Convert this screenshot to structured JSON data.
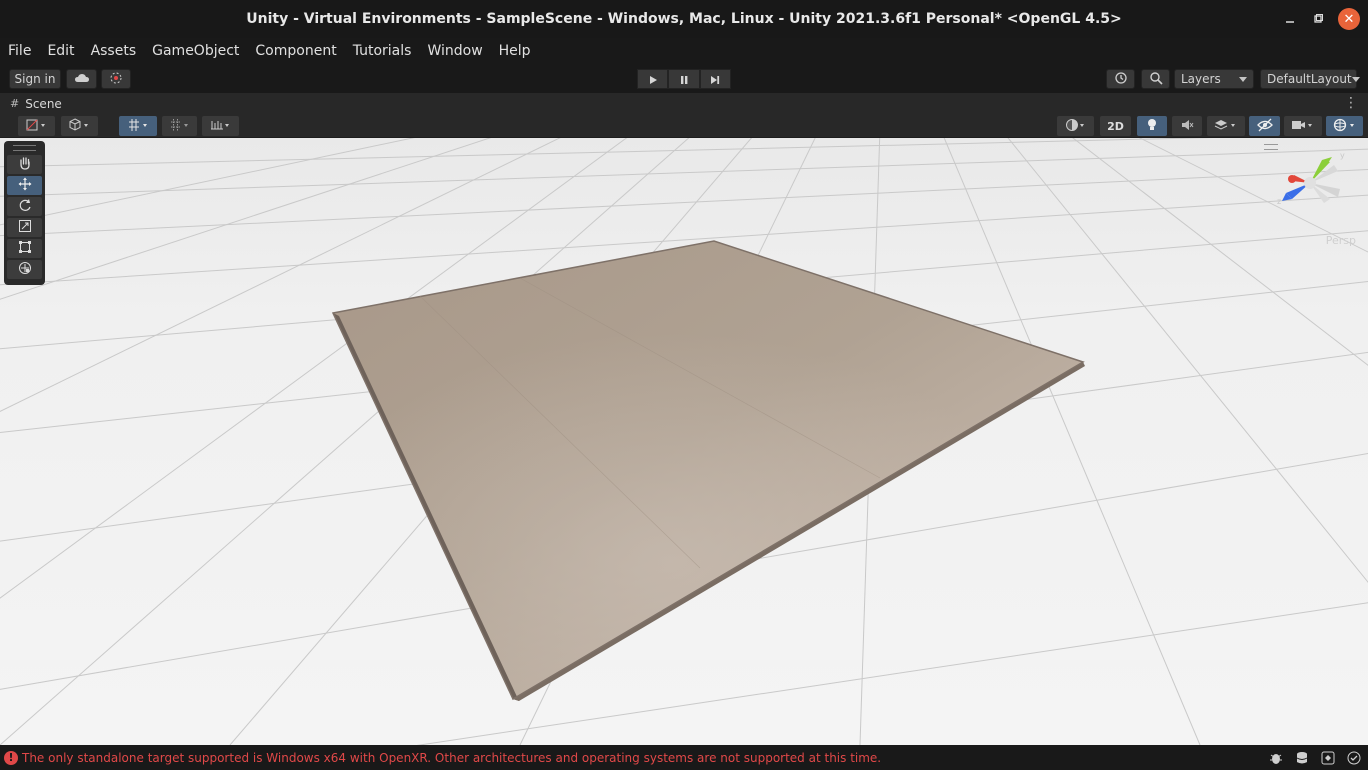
{
  "window": {
    "title": "Unity - Virtual Environments - SampleScene - Windows, Mac, Linux - Unity 2021.3.6f1 Personal* <OpenGL 4.5>",
    "controls": [
      "minimize-icon",
      "maximize-icon",
      "close-icon"
    ],
    "close_color": "#e9643a"
  },
  "menu": {
    "items": [
      "File",
      "Edit",
      "Assets",
      "GameObject",
      "Component",
      "Tutorials",
      "Window",
      "Help"
    ]
  },
  "toolbar": {
    "sign_in": "Sign in",
    "cloud_icon": "cloud-icon",
    "collab_icon": "collab-icon",
    "play_icons": [
      "play-icon",
      "pause-icon",
      "step-icon"
    ],
    "history_icon": "history-icon",
    "search_icon": "search-icon",
    "layers_label": "Layers",
    "layout_label": "DefaultLayout"
  },
  "scene_tab": {
    "label": "Scene"
  },
  "scene_toolbar": {
    "two_d_label": "2D",
    "accent_active": "#46607c"
  },
  "tools": [
    "hand-icon",
    "move-icon",
    "rotate-icon",
    "scale-icon",
    "rect-icon",
    "transform-icon"
  ],
  "gizmo": {
    "projection_label": "Persp",
    "axis_colors": {
      "x": "#e2473a",
      "y": "#8ccf3a",
      "z": "#3a6ee8"
    }
  },
  "status": {
    "message": "The only standalone target supported is Windows x64 with OpenXR.  Other architectures and operating systems are not supported at this time.",
    "color": "#e04848"
  }
}
